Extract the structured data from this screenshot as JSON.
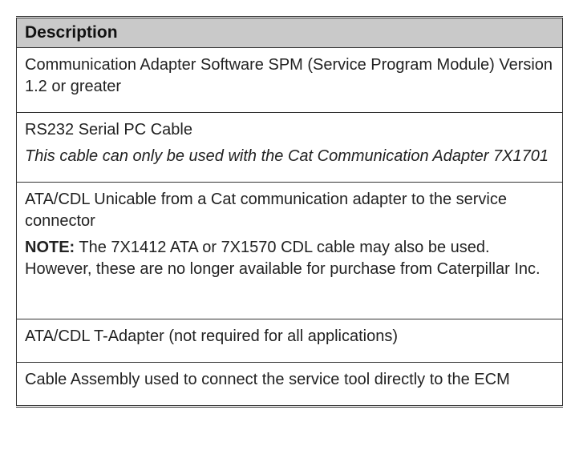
{
  "header": "Description",
  "rows": {
    "r1": {
      "text": "Communication Adapter Software SPM (Service Program Module) Version 1.2 or greater"
    },
    "r2": {
      "line1": "RS232 Serial PC Cable",
      "line2": "This cable can only be used with the Cat Communication Adapter 7X1701"
    },
    "r3": {
      "line1": "ATA/CDL Unicable from a Cat communication adapter to the service connector",
      "note_label": "NOTE:",
      "note_text": " The 7X1412 ATA or 7X1570 CDL cable may also be used. However, these are no longer available for purchase from Caterpillar Inc."
    },
    "r4": {
      "text": "ATA/CDL T-Adapter (not required for all applications)"
    },
    "r5": {
      "text": "Cable Assembly used to connect the service tool directly to the ECM"
    }
  }
}
